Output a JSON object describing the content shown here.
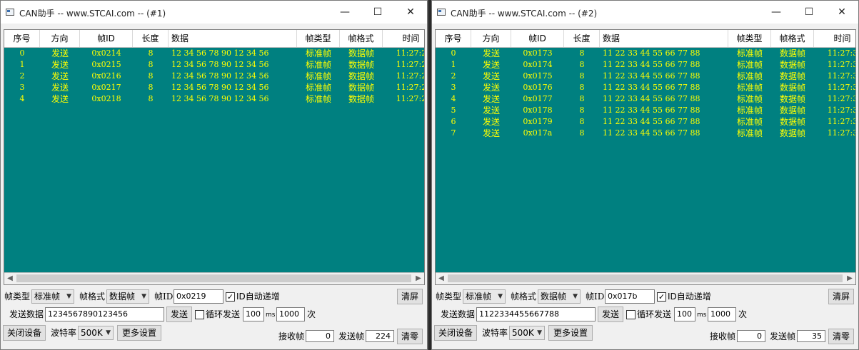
{
  "window1": {
    "title": "CAN助手 -- www.STCAI.com -- (#1)",
    "controls": {
      "minimize": "—",
      "maximize": "☐",
      "close": "✕"
    },
    "columns": [
      "序号",
      "方向",
      "帧ID",
      "长度",
      "数据",
      "帧类型",
      "帧格式",
      "时间"
    ],
    "rows": [
      {
        "idx": "0",
        "dir": "发送",
        "id": "0x0214",
        "len": "8",
        "data": "12 34 56 78 90 12 34 56",
        "type": "标准帧",
        "fmt": "数据帧",
        "time": "11:27:2"
      },
      {
        "idx": "1",
        "dir": "发送",
        "id": "0x0215",
        "len": "8",
        "data": "12 34 56 78 90 12 34 56",
        "type": "标准帧",
        "fmt": "数据帧",
        "time": "11:27:2"
      },
      {
        "idx": "2",
        "dir": "发送",
        "id": "0x0216",
        "len": "8",
        "data": "12 34 56 78 90 12 34 56",
        "type": "标准帧",
        "fmt": "数据帧",
        "time": "11:27:2"
      },
      {
        "idx": "3",
        "dir": "发送",
        "id": "0x0217",
        "len": "8",
        "data": "12 34 56 78 90 12 34 56",
        "type": "标准帧",
        "fmt": "数据帧",
        "time": "11:27:2"
      },
      {
        "idx": "4",
        "dir": "发送",
        "id": "0x0218",
        "len": "8",
        "data": "12 34 56 78 90 12 34 56",
        "type": "标准帧",
        "fmt": "数据帧",
        "time": "11:27:2"
      }
    ],
    "frame_type_label": "帧类型",
    "frame_type_value": "标准帧",
    "frame_format_label": "帧格式",
    "frame_format_value": "数据帧",
    "frame_id_label": "帧ID",
    "frame_id_value": "0x0219",
    "auto_inc_label": "ID自动递增",
    "auto_inc_checked": "✓",
    "clear_screen": "清屏",
    "send_data_label": "发送数据",
    "send_data_value": "1234567890123456",
    "send_button": "发送",
    "loop_label": "循环发送",
    "loop_checked": "",
    "interval_value": "100",
    "ms_label": "ms",
    "count_value": "1000",
    "count_unit": "次",
    "close_device": "关闭设备",
    "baud_label": "波特率",
    "baud_value": "500K",
    "more_settings": "更多设置",
    "recv_label": "接收帧",
    "recv_count": "0",
    "sent_label": "发送帧",
    "sent_count": "224",
    "clear_zero": "清零"
  },
  "window2": {
    "title": "CAN助手 -- www.STCAI.com -- (#2)",
    "controls": {
      "minimize": "—",
      "maximize": "☐",
      "close": "✕"
    },
    "columns": [
      "序号",
      "方向",
      "帧ID",
      "长度",
      "数据",
      "帧类型",
      "帧格式",
      "时间"
    ],
    "rows": [
      {
        "idx": "0",
        "dir": "发送",
        "id": "0x0173",
        "len": "8",
        "data": "11 22 33 44 55 66 77 88",
        "type": "标准帧",
        "fmt": "数据帧",
        "time": "11:27:3"
      },
      {
        "idx": "1",
        "dir": "发送",
        "id": "0x0174",
        "len": "8",
        "data": "11 22 33 44 55 66 77 88",
        "type": "标准帧",
        "fmt": "数据帧",
        "time": "11:27:3"
      },
      {
        "idx": "2",
        "dir": "发送",
        "id": "0x0175",
        "len": "8",
        "data": "11 22 33 44 55 66 77 88",
        "type": "标准帧",
        "fmt": "数据帧",
        "time": "11:27:3"
      },
      {
        "idx": "3",
        "dir": "发送",
        "id": "0x0176",
        "len": "8",
        "data": "11 22 33 44 55 66 77 88",
        "type": "标准帧",
        "fmt": "数据帧",
        "time": "11:27:3"
      },
      {
        "idx": "4",
        "dir": "发送",
        "id": "0x0177",
        "len": "8",
        "data": "11 22 33 44 55 66 77 88",
        "type": "标准帧",
        "fmt": "数据帧",
        "time": "11:27:3"
      },
      {
        "idx": "5",
        "dir": "发送",
        "id": "0x0178",
        "len": "8",
        "data": "11 22 33 44 55 66 77 88",
        "type": "标准帧",
        "fmt": "数据帧",
        "time": "11:27:3"
      },
      {
        "idx": "6",
        "dir": "发送",
        "id": "0x0179",
        "len": "8",
        "data": "11 22 33 44 55 66 77 88",
        "type": "标准帧",
        "fmt": "数据帧",
        "time": "11:27:3"
      },
      {
        "idx": "7",
        "dir": "发送",
        "id": "0x017a",
        "len": "8",
        "data": "11 22 33 44 55 66 77 88",
        "type": "标准帧",
        "fmt": "数据帧",
        "time": "11:27:3"
      }
    ],
    "frame_type_label": "帧类型",
    "frame_type_value": "标准帧",
    "frame_format_label": "帧格式",
    "frame_format_value": "数据帧",
    "frame_id_label": "帧ID",
    "frame_id_value": "0x017b",
    "auto_inc_label": "ID自动递增",
    "auto_inc_checked": "✓",
    "clear_screen": "清屏",
    "send_data_label": "发送数据",
    "send_data_value": "1122334455667788",
    "send_button": "发送",
    "loop_label": "循环发送",
    "loop_checked": "",
    "interval_value": "100",
    "ms_label": "ms",
    "count_value": "1000",
    "count_unit": "次",
    "close_device": "关闭设备",
    "baud_label": "波特率",
    "baud_value": "500K",
    "more_settings": "更多设置",
    "recv_label": "接收帧",
    "recv_count": "0",
    "sent_label": "发送帧",
    "sent_count": "35",
    "clear_zero": "清零"
  },
  "colors": {
    "grid_bg": "#008080",
    "row_text": "#ffff00",
    "taskbar_accent": "#1e6fd0"
  },
  "icons": {
    "scroll_left": "◀",
    "scroll_right": "▶",
    "dropdown": "▼"
  }
}
